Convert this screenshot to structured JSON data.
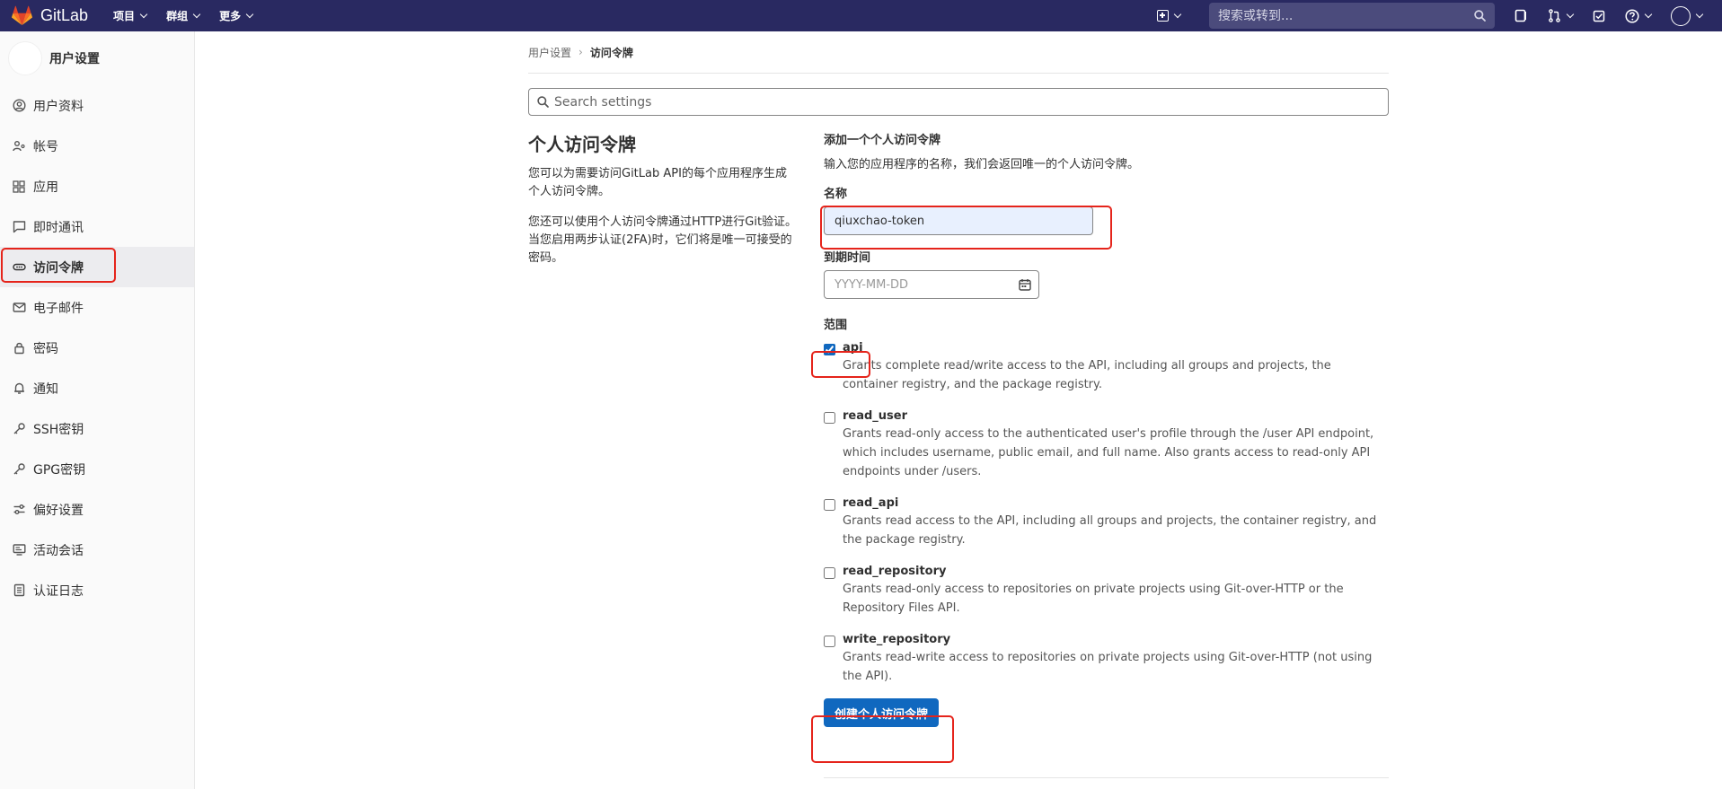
{
  "navbar": {
    "brand": "GitLab",
    "menus": [
      {
        "label": "项目"
      },
      {
        "label": "群组"
      },
      {
        "label": "更多"
      }
    ],
    "search_placeholder": "搜索或转到..."
  },
  "sidebar": {
    "title": "用户设置",
    "items": [
      {
        "label": "用户资料",
        "icon": "profile-icon"
      },
      {
        "label": "帐号",
        "icon": "account-icon"
      },
      {
        "label": "应用",
        "icon": "applications-icon"
      },
      {
        "label": "即时通讯",
        "icon": "chat-icon"
      },
      {
        "label": "访问令牌",
        "icon": "token-icon"
      },
      {
        "label": "电子邮件",
        "icon": "mail-icon"
      },
      {
        "label": "密码",
        "icon": "lock-icon"
      },
      {
        "label": "通知",
        "icon": "bell-icon"
      },
      {
        "label": "SSH密钥",
        "icon": "key-icon"
      },
      {
        "label": "GPG密钥",
        "icon": "key-icon"
      },
      {
        "label": "偏好设置",
        "icon": "preferences-icon"
      },
      {
        "label": "活动会话",
        "icon": "monitor-icon"
      },
      {
        "label": "认证日志",
        "icon": "log-icon"
      }
    ]
  },
  "breadcrumb": {
    "parent": "用户设置",
    "separator": "›",
    "current": "访问令牌"
  },
  "settings_search": {
    "placeholder": "Search settings"
  },
  "info": {
    "title": "个人访问令牌",
    "p1": "您可以为需要访问GitLab API的每个应用程序生成个人访问令牌。",
    "p2": "您还可以使用个人访问令牌通过HTTP进行Git验证。 当您启用两步认证(2FA)时，它们将是唯一可接受的密码。"
  },
  "form": {
    "title": "添加一个个人访问令牌",
    "description": "输入您的应用程序的名称，我们会返回唯一的个人访问令牌。",
    "name_label": "名称",
    "name_value": "qiuxchao-token",
    "expires_label": "到期时间",
    "expires_placeholder": "YYYY-MM-DD",
    "scopes_label": "范围",
    "scopes": [
      {
        "name": "api",
        "checked": true,
        "description": "Grants complete read/write access to the API, including all groups and projects, the container registry, and the package registry."
      },
      {
        "name": "read_user",
        "checked": false,
        "description": "Grants read-only access to the authenticated user's profile through the /user API endpoint, which includes username, public email, and full name. Also grants access to read-only API endpoints under /users."
      },
      {
        "name": "read_api",
        "checked": false,
        "description": "Grants read access to the API, including all groups and projects, the container registry, and the package registry."
      },
      {
        "name": "read_repository",
        "checked": false,
        "description": "Grants read-only access to repositories on private projects using Git-over-HTTP or the Repository Files API."
      },
      {
        "name": "write_repository",
        "checked": false,
        "description": "Grants read-write access to repositories on private projects using Git-over-HTTP (not using the API)."
      }
    ],
    "submit_label": "创建个人访问令牌"
  },
  "colors": {
    "navbar": "#292961",
    "primary": "#1068bf",
    "highlight": "#e5241b"
  }
}
